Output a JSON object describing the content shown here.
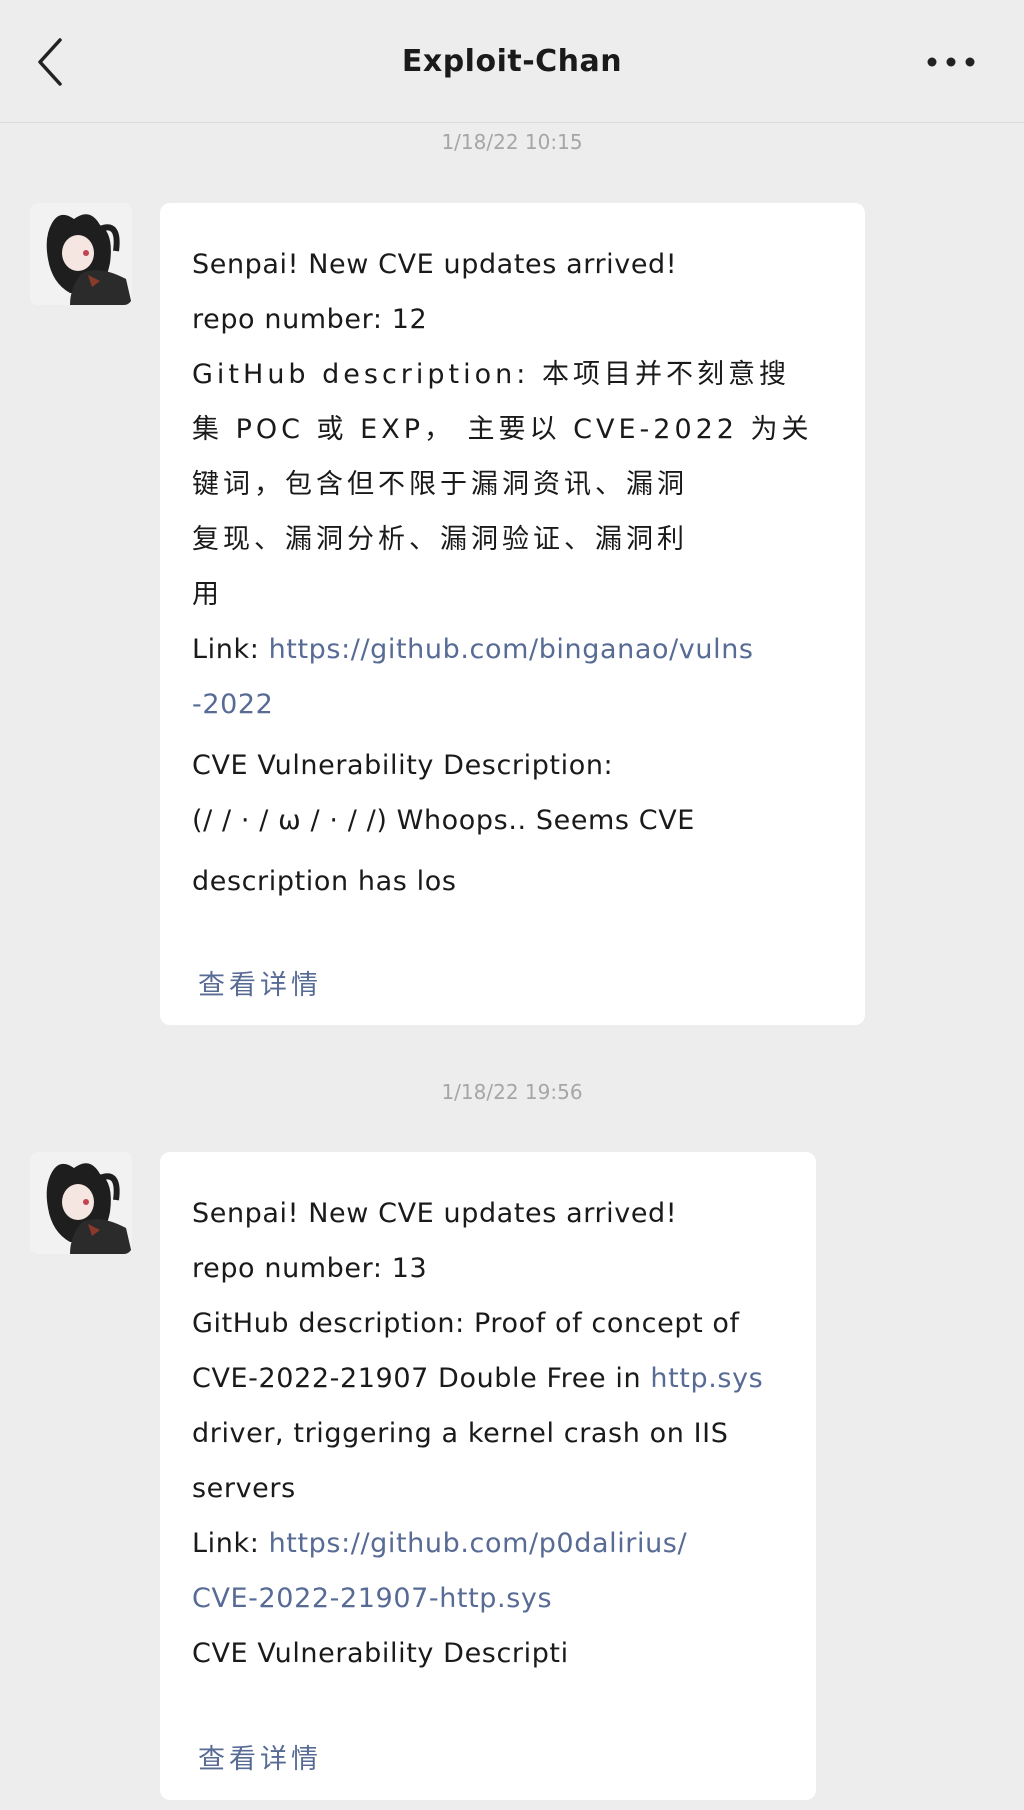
{
  "header": {
    "title": "Exploit-Chan"
  },
  "messages": [
    {
      "timestamp": "1/18/22 10:15",
      "line1": "Senpai! New CVE updates arrived!",
      "repo": "repo number: 12",
      "desc_line1": "GitHub description: 本项目并不刻意搜",
      "desc_line2": "集 POC 或 EXP， 主要以 CVE-2022 为关",
      "desc_line3": "键词，包含但不限于漏洞资讯、漏洞",
      "desc_line4": "复现、漏洞分析、漏洞验证、漏洞利",
      "desc_line5": "用",
      "link_prefix": "Link: ",
      "link_line1": "https://github.com/binganao/vulns",
      "link_line2": "-2022",
      "vuln_title": "CVE Vulnerability Description:",
      "vuln_line1": "(/ / · / ω / · / /) Whoops.. Seems CVE",
      "vuln_line2": "description has los",
      "details_label": "查看详情"
    },
    {
      "timestamp": "1/18/22 19:56",
      "line1": "Senpai! New CVE updates arrived!",
      "repo": "repo number: 13",
      "desc_line1": "GitHub description: Proof of concept of",
      "desc_line2_prefix": "CVE-2022-21907 Double Free in ",
      "desc_line2_link": "http.sys",
      "desc_line3": "driver, triggering a kernel crash on IIS",
      "desc_line4": "servers",
      "link_prefix": "Link: ",
      "link_line1": "https://github.com/p0dalirius/",
      "link_line2": "CVE-2022-21907-http.sys",
      "vuln_title": "CVE Vulnerability Descripti",
      "details_label": "查看详情"
    }
  ],
  "colors": {
    "background": "#ededed",
    "bubble": "#ffffff",
    "link": "#576b95",
    "timestamp": "#a6a6a6"
  },
  "icons": {
    "back": "chevron-left-icon",
    "more": "more-dots-icon"
  }
}
